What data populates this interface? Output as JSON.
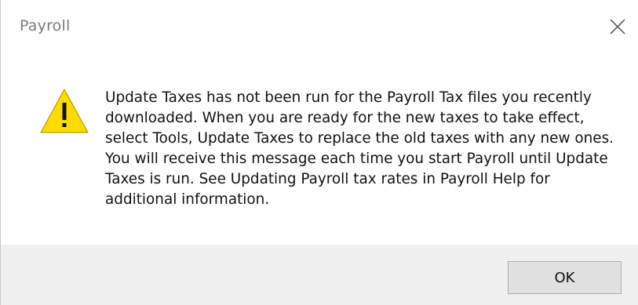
{
  "window": {
    "title": "Payroll",
    "close_icon": "close-icon"
  },
  "message": {
    "icon": "warning-icon",
    "icon_color": "#fcdb00",
    "text": "Update Taxes has not been run for the Payroll Tax files you recently downloaded. When you are ready for the new taxes to take effect, select Tools, Update Taxes to replace the old taxes with any new ones. You will receive this message each time you start Payroll until Update Taxes is run. See Updating Payroll tax rates in Payroll Help for additional information."
  },
  "footer": {
    "ok_label": "OK"
  }
}
